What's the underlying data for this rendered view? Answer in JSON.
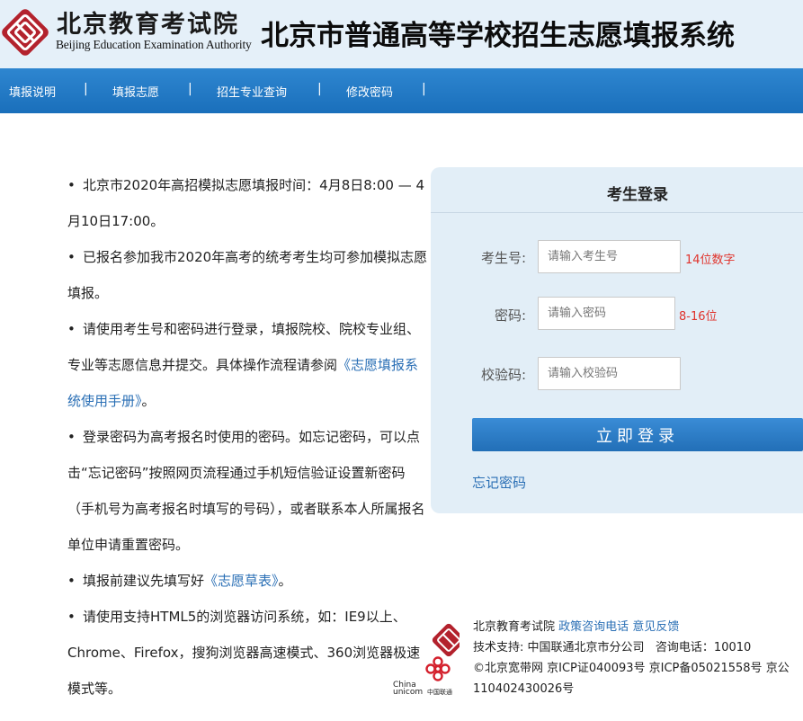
{
  "header": {
    "logo_cn": "北京教育考试院",
    "logo_en": "Beijing Education Examination Authority",
    "system_title": "北京市普通高等学校招生志愿填报系统"
  },
  "nav": {
    "items": [
      {
        "label": "填报说明"
      },
      {
        "label": "填报志愿"
      },
      {
        "label": "招生专业查询"
      },
      {
        "label": "修改密码"
      }
    ],
    "separator": "|"
  },
  "notices": {
    "bullet": "•",
    "n1": "北京市2020年高招模拟志愿填报时间：4月8日8:00 — 4月10日17:00。",
    "n2": "已报名参加我市2020年高考的统考考生均可参加模拟志愿填报。",
    "n3_before": "请使用考生号和密码进行登录，填报院校、院校专业组、专业等志愿信息并提交。具体操作流程请参阅",
    "n3_link": "《志愿填报系统使用手册》",
    "n3_after": "。",
    "n4": "登录密码为高考报名时使用的密码。如忘记密码，可以点击“忘记密码”按照网页流程通过手机短信验证设置新密码（手机号为高考报名时填写的号码），或者联系本人所属报名单位申请重置密码。",
    "n5_before": "填报前建议先填写好",
    "n5_link": "《志愿草表》",
    "n5_after": "。",
    "n6": "请使用支持HTML5的浏览器访问系统，如：IE9以上、Chrome、Firefox，搜狗浏览器高速模式、360浏览器极速模式等。"
  },
  "login": {
    "title": "考生登录",
    "exam_no_label": "考生号:",
    "exam_no_placeholder": "请输入考生号",
    "exam_no_hint": "14位数字",
    "password_label": "密码:",
    "password_placeholder": "请输入密码",
    "password_hint": "8-16位",
    "captcha_label": "校验码:",
    "captcha_placeholder": "请输入校验码",
    "submit_label": "立即登录",
    "forgot_label": "忘记密码"
  },
  "footer": {
    "org": "北京教育考试院",
    "policy_link": "政策咨询电话",
    "feedback_link": "意见反馈",
    "tech_support": "技术支持: 中国联通北京市分公司",
    "hotline": "咨询电话：10010",
    "icp": "©北京宽带网 京ICP证040093号 京ICP备05021558号 京公",
    "icp2": "110402430026号",
    "unicom_cn": "中国联通",
    "unicom_en1": "China",
    "unicom_en2": "unicom"
  },
  "colors": {
    "brand_red": "#b3222d",
    "nav_blue": "#1f77c4",
    "link_blue": "#2a6fb5",
    "hint_red": "#e0322b",
    "header_bg": "#e5f0f9"
  }
}
